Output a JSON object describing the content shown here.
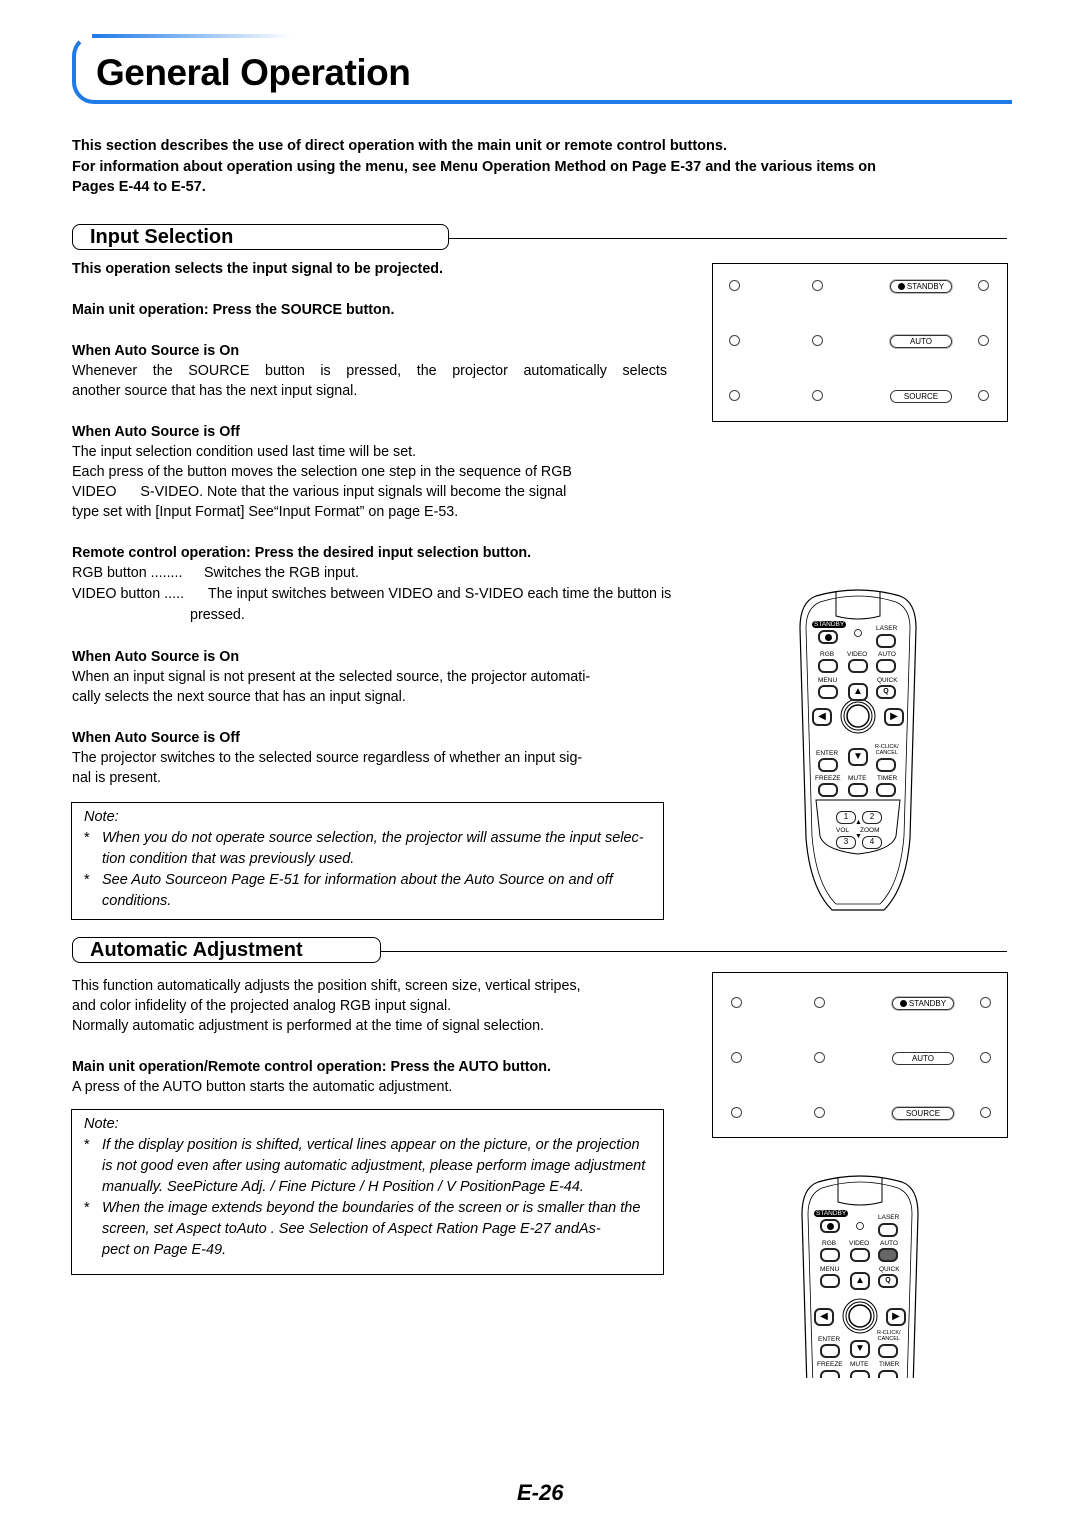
{
  "header": {
    "title": "General Operation",
    "accent_color": "#1e7be8"
  },
  "intro": {
    "line1": "This section describes the use of direct operation with the main unit or remote control buttons.",
    "line2": "For information about operation using the menu, see   Menu Operation Method   on Page E-37 and the various items on",
    "line3": "Pages E-44 to E-57."
  },
  "input_selection": {
    "heading": "Input Selection",
    "lead": "This operation selects the input signal to be projected.",
    "main_unit_heading": "Main unit operation: Press the SOURCE button.",
    "auto_on_heading": "When Auto Source is On",
    "auto_on_text1": "Whenever the SOURCE button is pressed, the projector automatically selects",
    "auto_on_text2": "another source that has the next input signal.",
    "auto_off_heading": "When Auto Source is Off",
    "auto_off_text1": "The input selection condition used last time will be set.",
    "auto_off_text2": "Each press of the button moves the selection one step in the sequence of RGB",
    "auto_off_text3": "VIDEO      S-VIDEO. Note that the various input signals will become the signal",
    "auto_off_text4": "type set with [Input Format] See“Input Format” on page E-53.",
    "remote_heading": "Remote control operation: Press the desired input selection button.",
    "rgb_term": "RGB button ........",
    "rgb_desc": "Switches the RGB input.",
    "video_term": "VIDEO button .....",
    "video_desc1": "The input switches between VIDEO and S-VIDEO each time the button is",
    "video_desc2": "pressed.",
    "remote_on_heading": "When Auto Source is On",
    "remote_on_text1": "When an input signal is not present at the selected source, the projector automati-",
    "remote_on_text2": "cally selects the next source that has an input signal.",
    "remote_off_heading": "When Auto Source is Off",
    "remote_off_text1": "The projector switches to the selected source regardless of whether an input sig-",
    "remote_off_text2": "nal is present.",
    "note": {
      "label": "Note:",
      "items": [
        {
          "l1": "When you do not operate source selection, the projector will assume the input selec-",
          "l2": "tion condition that was previously used."
        },
        {
          "l1": "See  Auto Sourceon Page E-51 for information about the Auto Source on and off",
          "l2": "conditions."
        }
      ]
    }
  },
  "automatic_adjustment": {
    "heading": "Automatic Adjustment",
    "text1": "This function automatically adjusts the position shift, screen size, vertical stripes,",
    "text2": "and color infidelity of the projected analog RGB input signal.",
    "text3": "Normally automatic adjustment is performed at the time of signal selection.",
    "op_heading": "Main unit operation/Remote control operation: Press the AUTO button.",
    "op_text": "A press of the AUTO button starts the automatic adjustment.",
    "note": {
      "label": "Note:",
      "items": [
        {
          "l1": "If the display position is shifted, vertical lines appear on the picture, or the projection",
          "l2": "is not good even after using automatic adjustment, please perform image adjustment",
          "l3": "manually. SeePicture Adj. / Fine Picture / H Position / V PositionPage E-44."
        },
        {
          "l1": "When the image extends beyond the boundaries of the screen or is smaller than the",
          "l2": "screen, set Aspect toAuto . See Selection of Aspect Ration Page E-27 andAs-",
          "l3": "pect  on Page E-49."
        }
      ]
    }
  },
  "panel": {
    "standby": "STANDBY",
    "auto": "AUTO",
    "source": "SOURCE"
  },
  "remote": {
    "standby": "STANDBY",
    "laser": "LASER",
    "rgb": "RGB",
    "video": "VIDEO",
    "auto": "AUTO",
    "menu": "MENU",
    "quick": "QUICK",
    "quick_glyph": "Q",
    "enter": "ENTER",
    "rclick1": "R-CLICK/",
    "rclick2": "CANCEL",
    "freeze": "FREEZE",
    "mute": "MUTE",
    "timer": "TIMER",
    "k1": "1",
    "k2": "2",
    "k3": "3",
    "k4": "4",
    "vol": "VOL",
    "zoom": "ZOOM"
  },
  "footer": {
    "page_number": "E-26"
  }
}
